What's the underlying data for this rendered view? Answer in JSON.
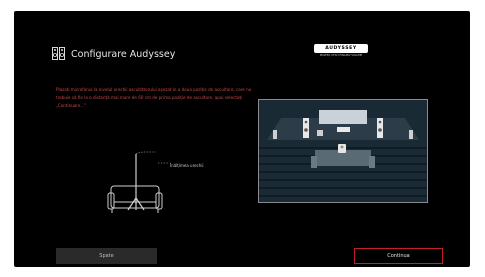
{
  "header": {
    "title": "Configurare Audyssey",
    "logo_text": "AUDYSSEY",
    "logo_subtitle": "MULTEQ XT32 DYNAMIC VOLUME"
  },
  "instructions": "Plasați microfonul la nivelul urechii ascultătorului aşezat în a doua poziție de ascultare, care nu trebuie să fie la o distanță mai mare de 60 cm de prima poziție de ascultare, apoi selectați „Continuare...\"",
  "mic_illustration": {
    "ear_height_label": "Înălțimea urechii"
  },
  "buttons": {
    "back_label": "Spate",
    "next_label": "Continua"
  },
  "colors": {
    "accent": "#c0202a",
    "text": "#e6e6e6",
    "instruction_text": "#c44a4a",
    "background": "#000000"
  }
}
